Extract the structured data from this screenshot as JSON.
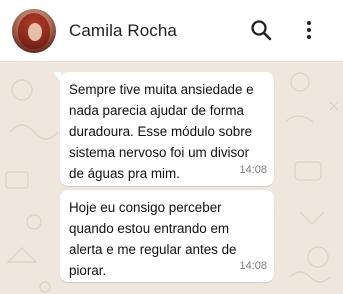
{
  "header": {
    "contact_name": "Camila Rocha",
    "icons": [
      "search-icon",
      "more-vert-icon"
    ]
  },
  "messages": [
    {
      "text": "Sempre tive muita ansiedade e nada parecia ajudar de forma duradoura. Esse módulo sobre sistema nervoso foi um divisor de águas pra mim.",
      "time": "14:08"
    },
    {
      "text": "Hoje eu consigo perceber quando estou entrando em alerta e me regular antes de piorar.",
      "time": "14:08"
    }
  ],
  "colors": {
    "chat_background": "#efe7dd",
    "bubble": "#ffffff",
    "header": "#ffffff"
  }
}
